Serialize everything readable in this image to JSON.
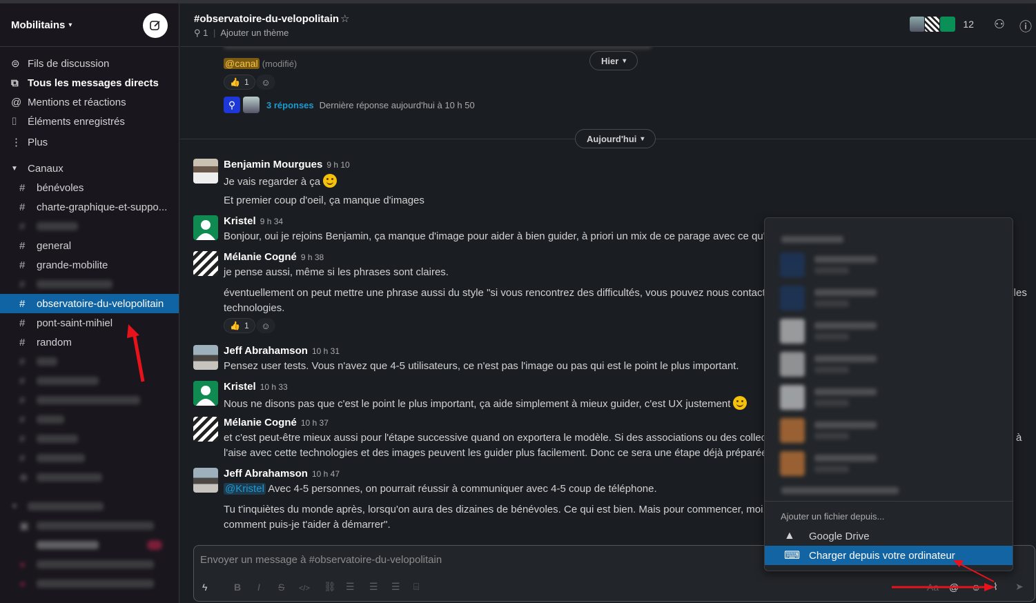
{
  "workspace": {
    "name": "Mobilitains",
    "caret": "⌄"
  },
  "nav": {
    "threads": "Fils de discussion",
    "dms": "Tous les messages directs",
    "mentions": "Mentions et réactions",
    "saved": "Éléments enregistrés",
    "more": "Plus"
  },
  "channels_section": {
    "label": "Canaux"
  },
  "channels": [
    {
      "name": "bénévoles"
    },
    {
      "name": "charte-graphique-et-suppo..."
    },
    {
      "name": "general"
    },
    {
      "name": "grande-mobilite"
    },
    {
      "name": "observatoire-du-velopolitain",
      "active": true
    },
    {
      "name": "pont-saint-mihiel"
    },
    {
      "name": "random"
    }
  ],
  "header": {
    "channel": "#observatoire-du-velopolitain",
    "pins": "1",
    "topic": "Ajouter un thème",
    "member_count": "12"
  },
  "previous": {
    "canal": "@canal",
    "modified": "(modifié)",
    "reaction_count": "1",
    "replies": "3 réponses",
    "last_reply": "Dernière réponse aujourd'hui à 10 h 50"
  },
  "date_pills": {
    "yesterday": "Hier",
    "today": "Aujourd'hui"
  },
  "messages": [
    {
      "author": "Benjamin Mourgues",
      "time": "9 h 10",
      "lines": [
        "Je vais regarder à ça",
        "Et premier coup d'oeil, ça manque d'images"
      ]
    },
    {
      "author": "Kristel",
      "time": "9 h 34",
      "lines": [
        "Bonjour, oui je rejoins Benjamin, ça manque d'image pour aider à bien guider, à priori un mix de ce parage avec ce qu'ava"
      ]
    },
    {
      "author": "Mélanie Cogné",
      "time": "9 h 38",
      "lines": [
        "je pense aussi, même si les phrases sont claires.",
        "éventuellement on peut mettre une phrase aussi du style \"si vous rencontrez des difficultés, vous pouvez nous contacter",
        "technologies.",
        "elles"
      ],
      "reaction_count": "1"
    },
    {
      "author": "Jeff Abrahamson",
      "time": "10 h 31",
      "lines": [
        "Pensez user tests.  Vous n'avez que 4-5 utilisateurs, ce n'est pas l'image ou pas qui est le point le plus important."
      ]
    },
    {
      "author": "Kristel",
      "time": "10 h 33",
      "lines": [
        "Nous ne disons pas que c'est le point le plus important, ça aide simplement à mieux guider, c'est UX justement"
      ]
    },
    {
      "author": "Mélanie Cogné",
      "time": "10 h 37",
      "lines": [
        "et c'est peut-être mieux aussi pour l'étape successive quand on exportera le modèle. Si des associations ou des collectiv",
        "l'aise avec cette technologies et des images peuvent les guider plus facilement. Donc ce sera une étape déjà préparée er",
        "à"
      ]
    },
    {
      "author": "Jeff Abrahamson",
      "time": "10 h 47",
      "mention": "@Kristel",
      "lines": [
        "Avec 4-5 personnes, on pourrait réussir à communiquer avec 4-5 coup de téléphone.",
        "Tu t'inquiètes du monde après, lorsqu'on aura des dizaines de bénévoles.  Ce qui est bien.  Mais pour commencer, moi, j'",
        "comment puis-je t'aider à démarrer\"."
      ]
    }
  ],
  "composer": {
    "placeholder": "Envoyer un message à #observatoire-du-velopolitain",
    "format_label": "Aa"
  },
  "attach_menu": {
    "label": "Ajouter un fichier depuis...",
    "items": [
      {
        "label": "Google Drive",
        "icon": "google-drive-icon"
      },
      {
        "label": "Charger depuis votre ordinateur",
        "icon": "computer-icon",
        "active": true
      }
    ]
  },
  "colors": {
    "accent": "#1164a3",
    "sidebar": "#19171d",
    "main": "#1a1d21",
    "link": "#1d9bd1",
    "annotation_arrow": "#e8121b"
  }
}
